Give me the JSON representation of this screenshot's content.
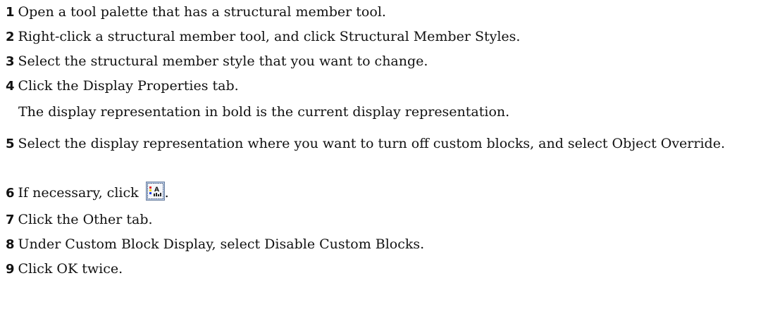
{
  "steps": [
    {
      "number": "1",
      "text": "Open a tool palette that has a structural member tool."
    },
    {
      "number": "2",
      "text": "Right-click a structural member tool, and click Structural Member Styles."
    },
    {
      "number": "3",
      "text": "Select the structural member style that you want to change."
    },
    {
      "number": "4",
      "text": "Click the Display Properties tab."
    },
    {
      "number": "5",
      "text": "Select the display representation where you want to turn off custom blocks, and select Object Override."
    },
    {
      "number": "6",
      "text": "If necessary, click",
      "suffix": "."
    },
    {
      "number": "7",
      "text": "Click the Other tab."
    },
    {
      "number": "8",
      "text": "Under Custom Block Display, select Disable Custom Blocks."
    },
    {
      "number": "9",
      "text": "Click OK twice."
    }
  ],
  "note_after_step_4": "The display representation in bold is the current display representation.",
  "icons": {
    "step6": "display-properties-icon"
  }
}
